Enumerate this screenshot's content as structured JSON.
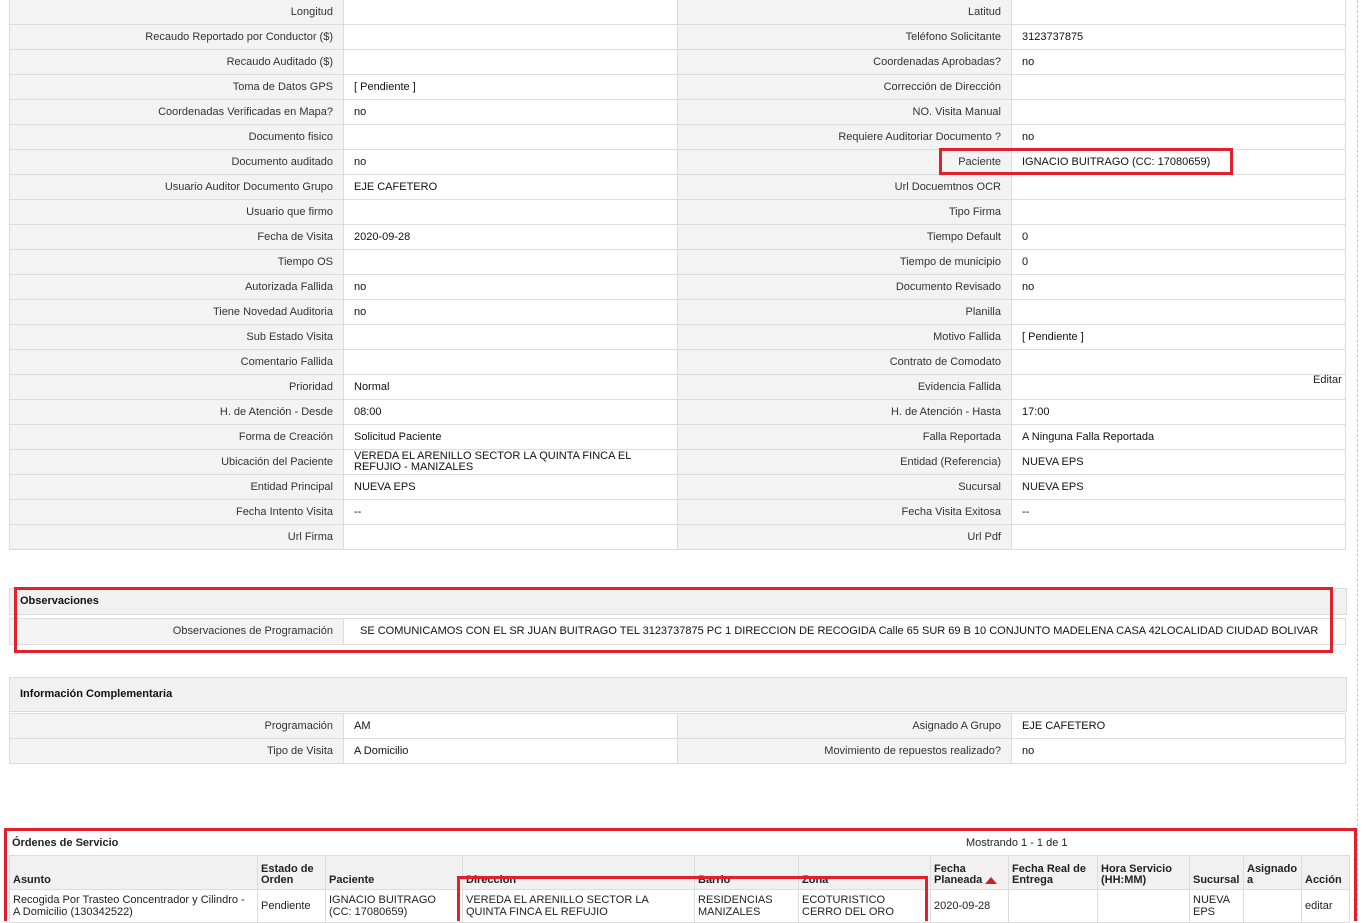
{
  "details": [
    [
      "Longitud",
      "",
      "Latitud",
      ""
    ],
    [
      "Recaudo Reportado por Conductor ($)",
      "",
      "Teléfono Solicitante",
      "3123737875"
    ],
    [
      "Recaudo Auditado ($)",
      "",
      "Coordenadas Aprobadas?",
      " no"
    ],
    [
      "Toma de Datos GPS",
      "[ Pendiente ]",
      "Corrección de Dirección",
      ""
    ],
    [
      "Coordenadas Verificadas en Mapa?",
      " no",
      "NO. Visita Manual",
      ""
    ],
    [
      "Documento fisico",
      "",
      "Requiere Auditoriar Documento ?",
      " no"
    ],
    [
      "Documento auditado",
      " no",
      "Paciente",
      "IGNACIO BUITRAGO (CC: 17080659)"
    ],
    [
      "Usuario Auditor Documento Grupo",
      "EJE CAFETERO",
      "Url Docuemtnos OCR",
      ""
    ],
    [
      "Usuario que firmo",
      "",
      "Tipo Firma",
      ""
    ],
    [
      "Fecha de Visita",
      " 2020-09-28",
      "Tiempo Default",
      "0"
    ],
    [
      "Tiempo OS",
      "",
      "Tiempo de municipio",
      "0"
    ],
    [
      "Autorizada Fallida",
      " no",
      "Documento Revisado",
      " no"
    ],
    [
      "Tiene Novedad Auditoria",
      " no",
      "Planilla",
      ""
    ],
    [
      "Sub Estado Visita",
      "",
      "Motivo Fallida",
      "[ Pendiente ]"
    ],
    [
      "Comentario Fallida",
      "",
      "Contrato de Comodato",
      ""
    ],
    [
      "Prioridad",
      "Normal",
      "Evidencia Fallida",
      ""
    ],
    [
      "H. de Atención - Desde",
      "08:00",
      "H. de Atención - Hasta",
      "17:00"
    ],
    [
      "Forma de Creación",
      "Solicitud Paciente",
      "Falla Reportada",
      "A Ninguna Falla Reportada"
    ],
    [
      "Ubicación del Paciente",
      "VEREDA EL ARENILLO SECTOR LA QUINTA FINCA EL REFUJIO - MANIZALES",
      "Entidad (Referencia)",
      "NUEVA EPS"
    ],
    [
      "Entidad Principal",
      "NUEVA EPS",
      "Sucursal",
      "NUEVA EPS"
    ],
    [
      "Fecha Intento Visita",
      " --",
      "Fecha Visita Exitosa",
      " --"
    ],
    [
      "Url Firma",
      "",
      "Url Pdf",
      ""
    ]
  ],
  "editar_label": "Editar",
  "observaciones": {
    "title": "Observaciones",
    "label": "Observaciones de Programación",
    "value": "SE COMUNICAMOS CON EL SR JUAN BUITRAGO TEL 3123737875 PC 1 DIRECCION DE RECOGIDA Calle 65 SUR 69 B 10 CONJUNTO MADELENA CASA 42LOCALIDAD CIUDAD BOLIVAR"
  },
  "complementaria": {
    "title": "Información Complementaria",
    "rows": [
      [
        "Programación",
        "AM",
        "Asignado A Grupo",
        "EJE CAFETERO"
      ],
      [
        "Tipo de Visita",
        "A Domicilio",
        "Movimiento de repuestos realizado?",
        " no"
      ]
    ]
  },
  "orders": {
    "title": "Órdenes de Servicio",
    "count_text": "Mostrando 1 - 1 de 1",
    "headers": [
      "Asunto",
      "Estado de Orden",
      "Paciente",
      "Direccion",
      "Barrio",
      "Zona",
      "Fecha Planeada",
      "Fecha Real de Entrega",
      "Hora Servicio (HH:MM)",
      "Sucursal",
      "Asignado a",
      "Acción"
    ],
    "rows": [
      {
        "asunto": "Recogida Por Trasteo Concentrador y Cilindro - A Domicilio (130342522)",
        "estado": "Pendiente",
        "paciente": "IGNACIO BUITRAGO (CC: 17080659)",
        "direccion": "VEREDA EL ARENILLO SECTOR LA QUINTA FINCA EL REFUJIO",
        "barrio": "RESIDENCIAS MANIZALES",
        "zona": "ECOTURISTICO CERRO DEL ORO",
        "fecha_planeada": "2020-09-28",
        "fecha_real": "",
        "hora": "",
        "sucursal": "NUEVA EPS",
        "asignado": "",
        "accion": "editar"
      }
    ]
  },
  "highlight_color": "#e0202a"
}
